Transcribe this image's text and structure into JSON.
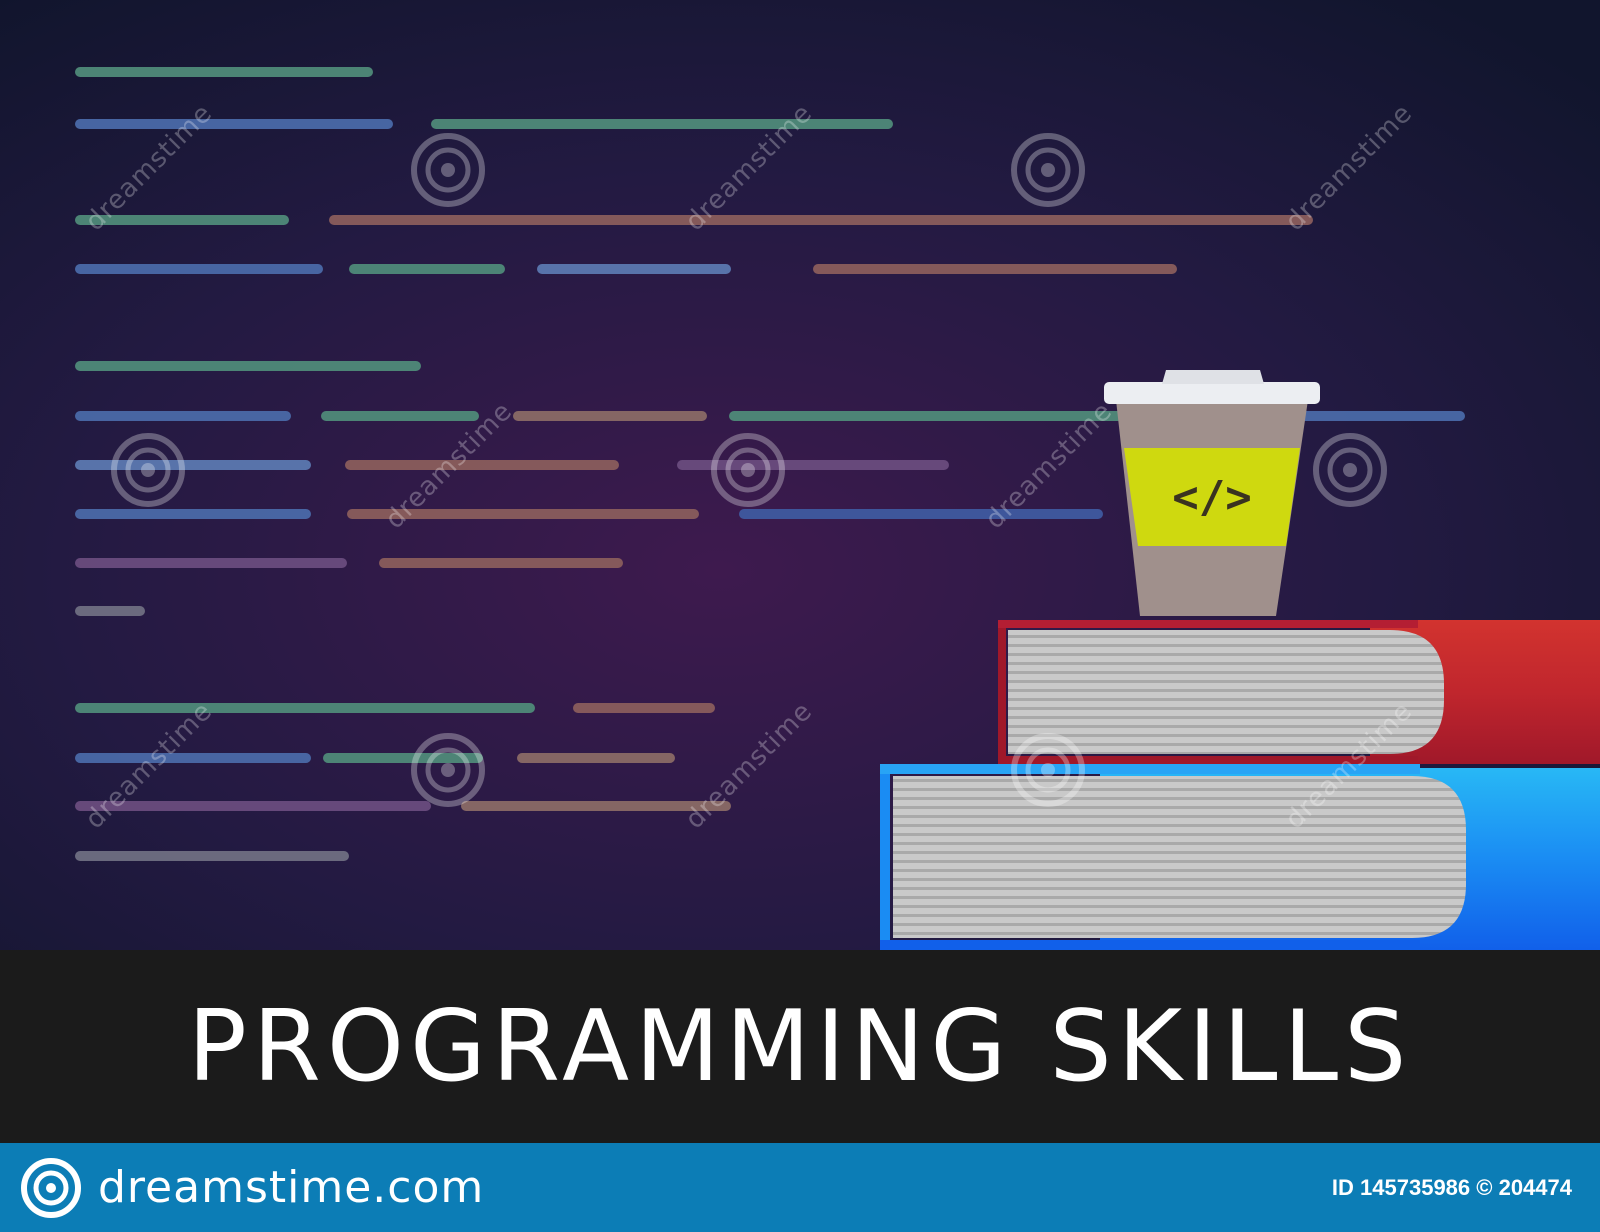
{
  "title": "PROGRAMMING SKILLS",
  "cup": {
    "code_symbol": "</>"
  },
  "watermark": {
    "text": "dreamstime"
  },
  "footer": {
    "site": "dreamstime.com",
    "id_text": "ID 145735986 © 204474"
  },
  "colors": {
    "background_center": "#3e1a4e",
    "background_edge": "#11152d",
    "title_band": "#1b1b1b",
    "footer": "#0c7db6",
    "cup_band": "#cfd90f",
    "cup_body": "#a0908c",
    "book_red": "#c0262d",
    "book_blue": "#1479f0",
    "code_green": "#4f8a79",
    "code_blue": "#4a6aa8",
    "code_orange": "#8a5d5c",
    "code_purple": "#6a4c7e",
    "code_gray": "#6f6f82"
  }
}
